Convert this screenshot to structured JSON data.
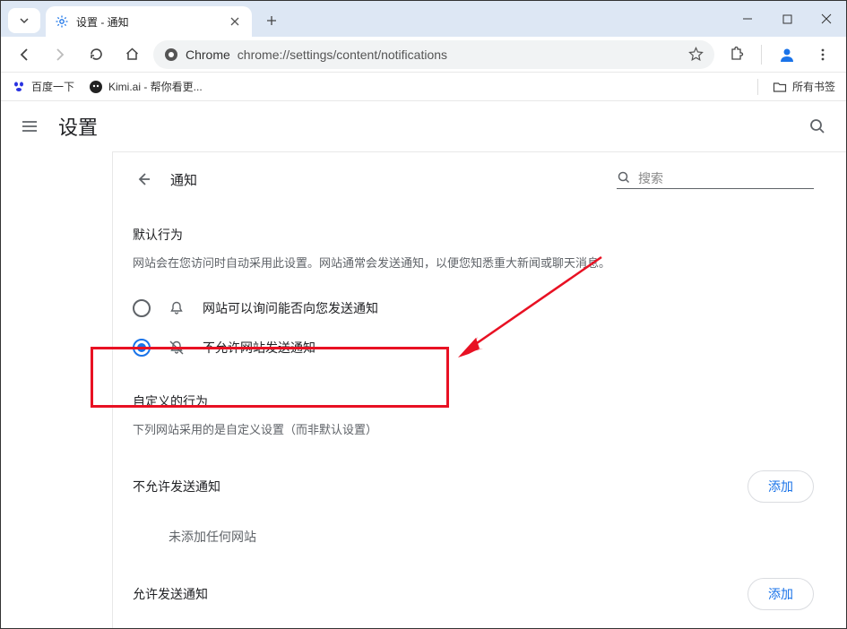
{
  "tab": {
    "title": "设置 - 通知"
  },
  "addressbar": {
    "prefix": "Chrome",
    "url": "chrome://settings/content/notifications"
  },
  "bookmarks": {
    "item1": "百度一下",
    "item2": "Kimi.ai - 帮你看更...",
    "all": "所有书签"
  },
  "header": {
    "title": "设置"
  },
  "panel": {
    "back_title": "通知",
    "search_placeholder": "搜索",
    "default_section_title": "默认行为",
    "default_section_desc": "网站会在您访问时自动采用此设置。网站通常会发送通知，以便您知悉重大新闻或聊天消息。",
    "option_ask": "网站可以询问能否向您发送通知",
    "option_block": "不允许网站发送通知",
    "custom_section_title": "自定义的行为",
    "custom_section_desc": "下列网站采用的是自定义设置（而非默认设置）",
    "blocked_title": "不允许发送通知",
    "empty_text": "未添加任何网站",
    "allowed_title": "允许发送通知",
    "add_button": "添加"
  }
}
